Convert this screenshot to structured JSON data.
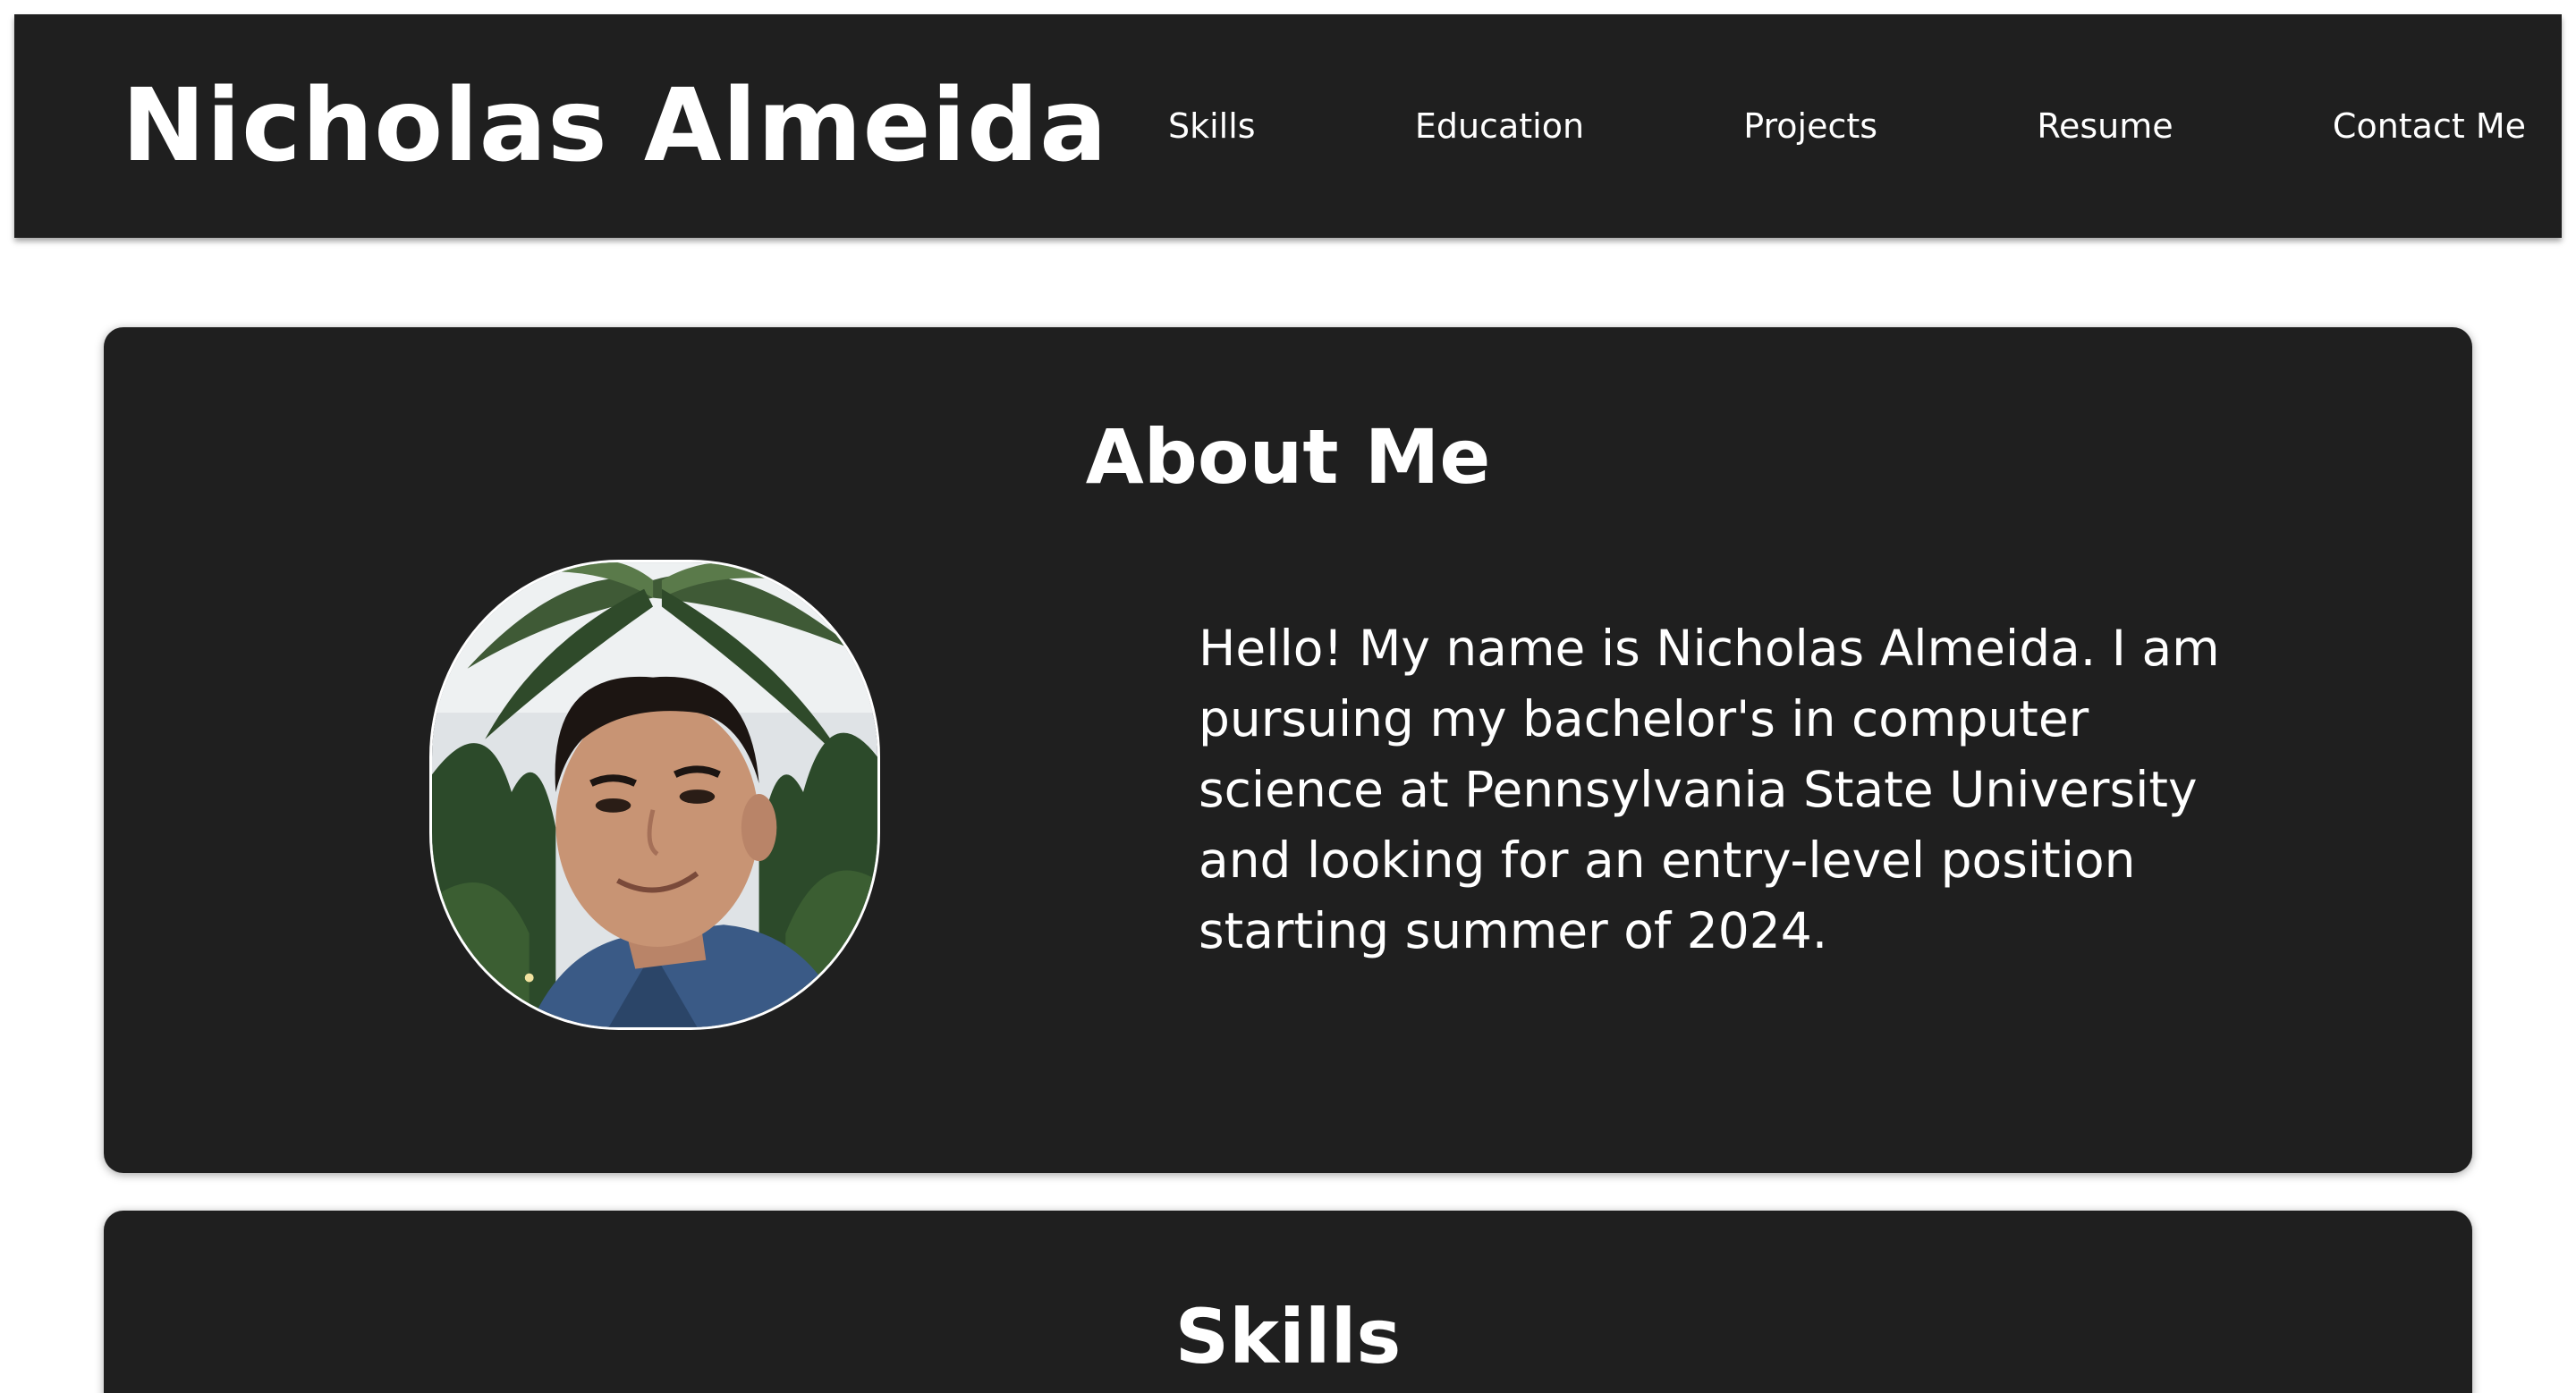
{
  "header": {
    "site_name": "Nicholas Almeida",
    "nav": [
      {
        "label": "Skills"
      },
      {
        "label": "Education"
      },
      {
        "label": "Projects"
      },
      {
        "label": "Resume"
      },
      {
        "label": "Contact Me"
      }
    ]
  },
  "about": {
    "title": "About Me",
    "bio": "Hello! My name is Nicholas Almeida. I am pursuing my bachelor's in computer science at Pennsylvania State University and looking for an entry-level position starting summer of 2024."
  },
  "skills": {
    "title": "Skills"
  },
  "colors": {
    "background": "#ffffff",
    "card": "#1f1f1f",
    "text": "#ffffff"
  }
}
